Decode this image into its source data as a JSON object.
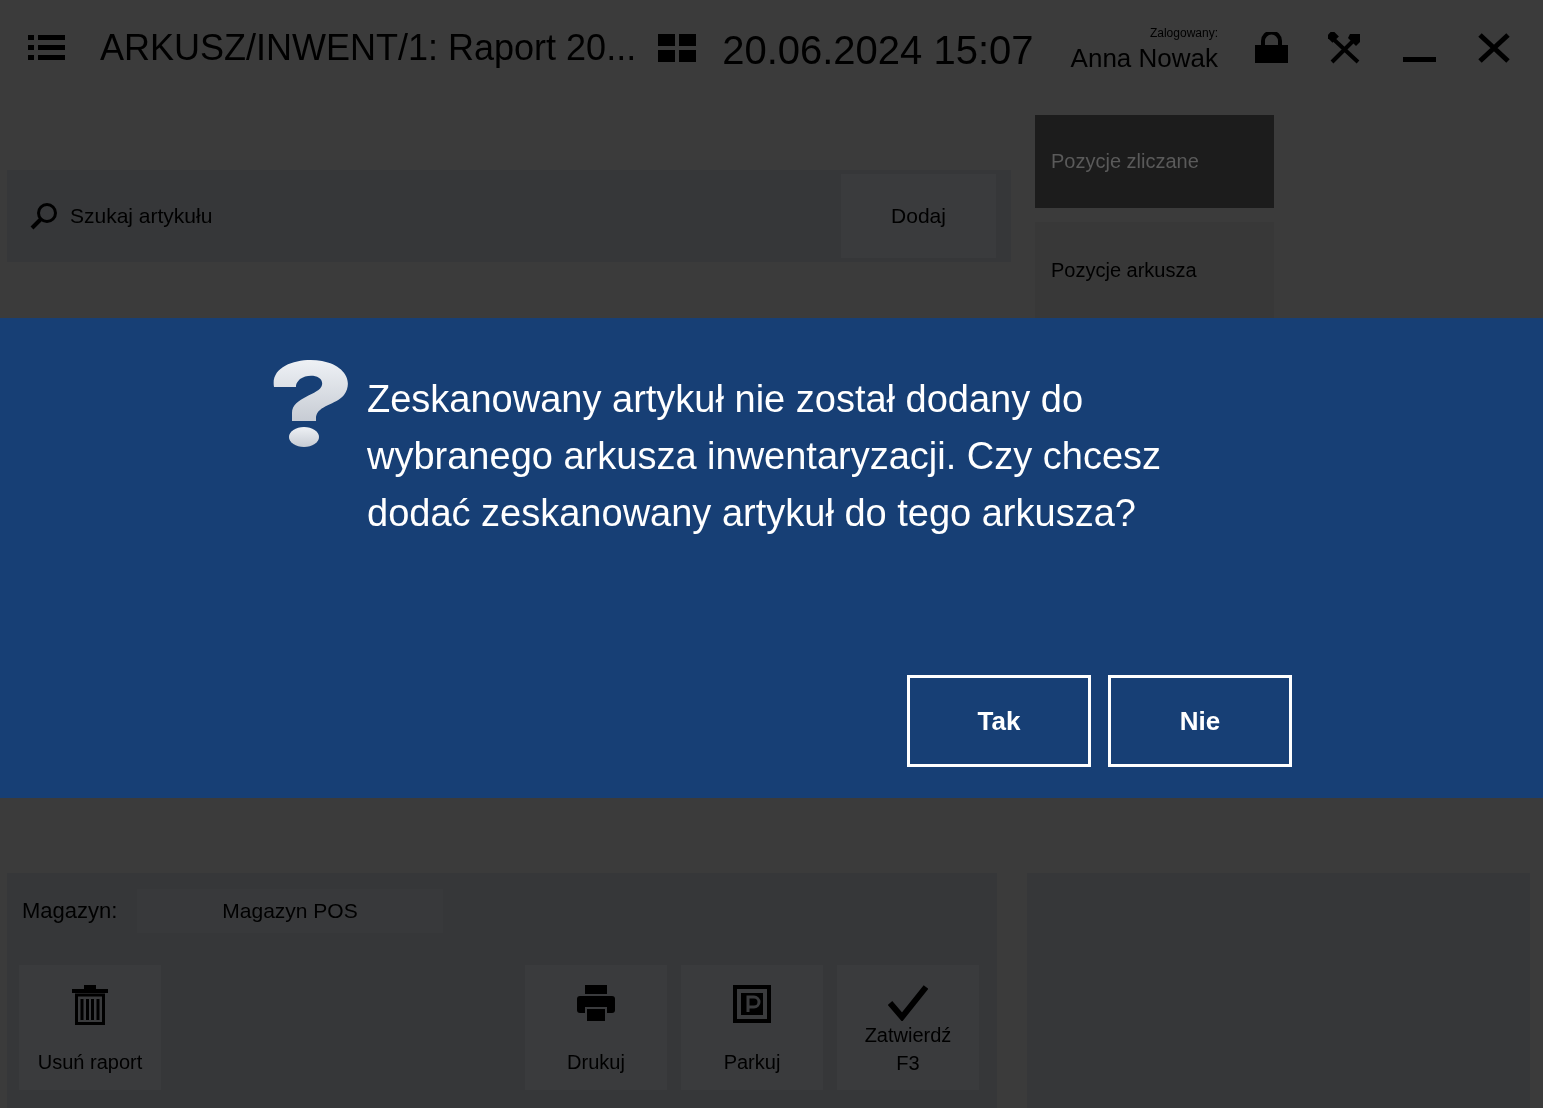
{
  "title_bar": {
    "title": "ARKUSZ/INWENT/1: Raport 20...",
    "datetime": "20.06.2024 15:07",
    "user_label": "Zalogowany:",
    "user_name": "Anna Nowak"
  },
  "search": {
    "placeholder": "Szukaj artykułu",
    "button": "Dodaj"
  },
  "tabs": [
    {
      "label": "Pozycje zliczane",
      "selected": true
    },
    {
      "label": "Pozycje arkusza",
      "selected": false
    }
  ],
  "dialog": {
    "message": "Zeskanowany artykuł nie został dodany do wybranego arkusza inwentaryzacji. Czy chcesz dodać zeskanowany artykuł do tego arkusza?",
    "buttons": [
      "Tak",
      "Nie"
    ]
  },
  "footer": {
    "field_label": "Magazyn:",
    "field_value": "Magazyn POS",
    "left_actions": [
      {
        "label": "Usuń raport",
        "kind": "trash"
      }
    ],
    "right_actions": [
      {
        "label": "Drukuj",
        "kind": "print"
      },
      {
        "label": "Parkuj",
        "kind": "park"
      },
      {
        "label": "Zatwierdź",
        "shortcut": "F3",
        "kind": "confirm"
      }
    ]
  }
}
